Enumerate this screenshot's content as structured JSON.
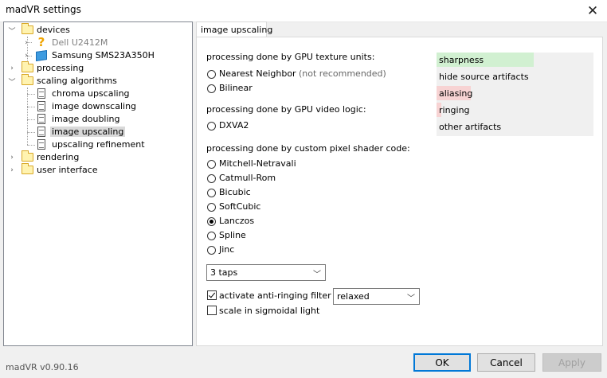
{
  "window": {
    "title": "madVR settings"
  },
  "tree": {
    "items": [
      {
        "label": "devices"
      },
      {
        "label": "Dell U2412M"
      },
      {
        "label": "Samsung SMS23A350H"
      },
      {
        "label": "processing"
      },
      {
        "label": "scaling algorithms"
      },
      {
        "label": "chroma upscaling"
      },
      {
        "label": "image downscaling"
      },
      {
        "label": "image doubling"
      },
      {
        "label": "image upscaling"
      },
      {
        "label": "upscaling refinement"
      },
      {
        "label": "rendering"
      },
      {
        "label": "user interface"
      }
    ],
    "selected": "image upscaling"
  },
  "tab": {
    "label": "image upscaling"
  },
  "texture_units": {
    "heading": "processing done by GPU texture units:",
    "options": [
      "Nearest Neighbor",
      "Bilinear"
    ],
    "note": "(not recommended)"
  },
  "video_logic": {
    "heading": "processing done by GPU video logic:",
    "options": [
      "DXVA2"
    ]
  },
  "pixel_shader": {
    "heading": "processing done by custom pixel shader code:",
    "options": [
      "Mitchell-Netravali",
      "Catmull-Rom",
      "Bicubic",
      "SoftCubic",
      "Lanczos",
      "Spline",
      "Jinc"
    ],
    "selected": "Lanczos"
  },
  "taps": {
    "value": "3 taps"
  },
  "anti_ringing": {
    "label": "activate anti-ringing filter",
    "checked": true,
    "mode": "relaxed"
  },
  "sigmoidal": {
    "label": "scale in sigmoidal light",
    "checked": false
  },
  "quality": [
    {
      "label": "sharpness",
      "level": 0.62,
      "color": "#d1f0d1"
    },
    {
      "label": "hide source artifacts",
      "level": 0,
      "color": "#d1f0d1"
    },
    {
      "label": "aliasing",
      "level": 0.22,
      "color": "#f7d3d3"
    },
    {
      "label": "ringing",
      "level": 0.03,
      "color": "#f7d3d3"
    },
    {
      "label": "other artifacts",
      "level": 0,
      "color": "#f7d3d3"
    }
  ],
  "footer": {
    "version": "madVR v0.90.16",
    "ok": "OK",
    "cancel": "Cancel",
    "apply": "Apply"
  },
  "icons": {
    "close": "close-icon",
    "folder": "folder-icon",
    "page": "page-icon",
    "unknown_monitor": "question-icon",
    "monitor": "monitor-icon",
    "expand": "chevron-down-icon",
    "collapse": "chevron-right-icon"
  }
}
